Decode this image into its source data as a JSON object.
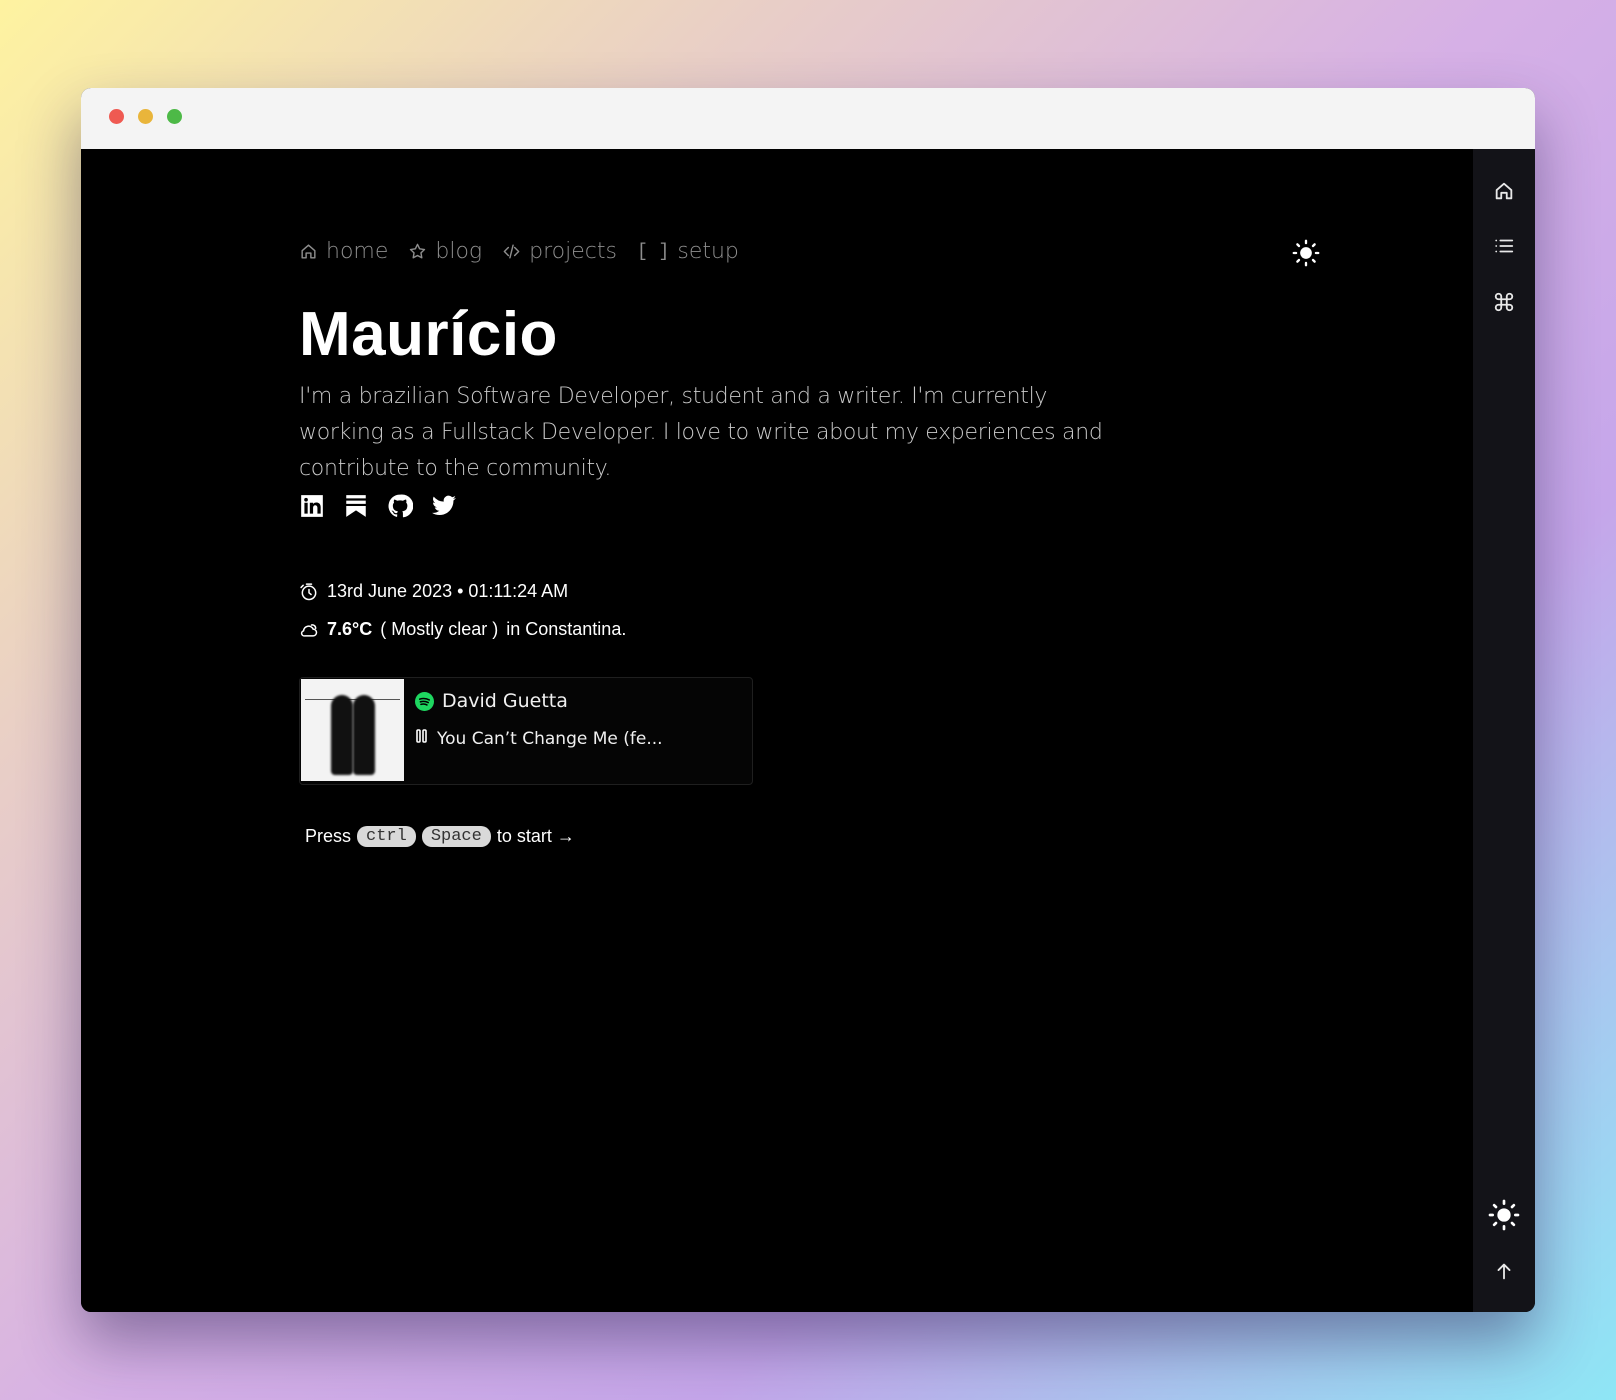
{
  "nav": {
    "home": "home",
    "blog": "blog",
    "projects": "projects",
    "setup_bracket": "[ ]",
    "setup": "setup"
  },
  "profile": {
    "name": "Maurício",
    "bio": "I'm a brazilian Software Developer, student and a writer. I'm currently working as a Fullstack Developer. I love to write about my experiences and contribute to the community."
  },
  "socials": [
    "linkedin-icon",
    "bookmark-icon",
    "github-icon",
    "twitter-icon"
  ],
  "clock": {
    "text": "13rd June 2023 • 01:11:24 AM"
  },
  "weather": {
    "temp": "7.6°C",
    "condition": "( Mostly clear )",
    "location": "in Constantina."
  },
  "spotify": {
    "artist": "David Guetta",
    "track": "You Can’t Change Me (fe...",
    "accent": "#1ed760"
  },
  "hint": {
    "press": "Press",
    "key1": "ctrl",
    "key2": "Space",
    "suffix": "to start →"
  },
  "rail": [
    "home-icon",
    "list-icon",
    "command-icon",
    "sun-icon",
    "arrow-up-icon"
  ]
}
